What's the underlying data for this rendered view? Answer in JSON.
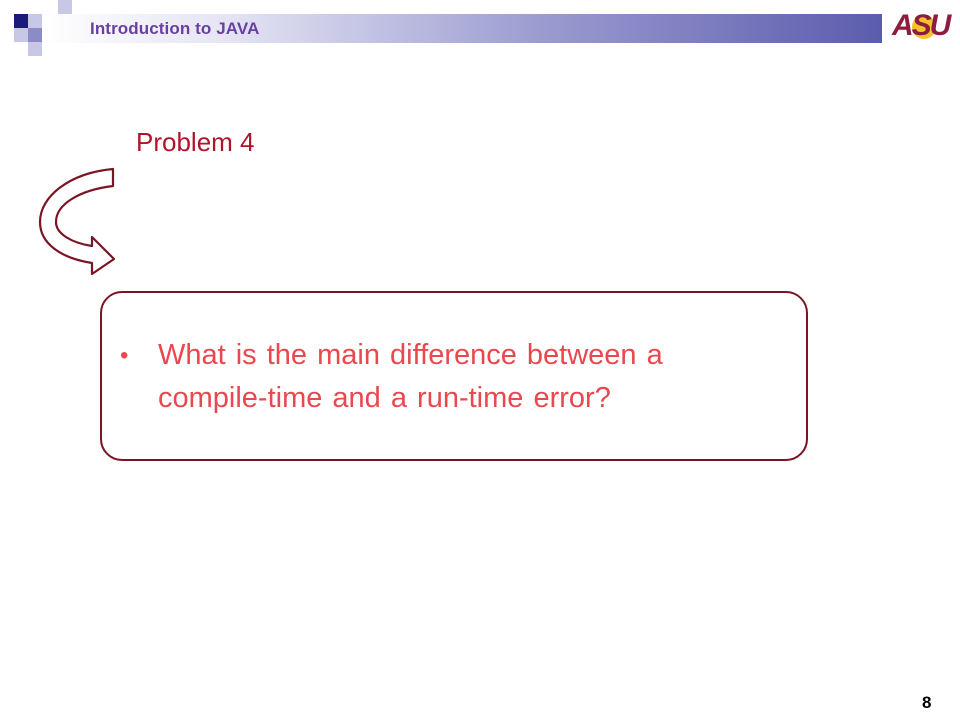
{
  "header": {
    "title": "Introduction to JAVA",
    "logo_text": "ASU"
  },
  "slide": {
    "problem_title": "Problem 4",
    "bullet": "•",
    "question": "What is the main difference between a compile-time and a run-time error?",
    "page_number": "8"
  },
  "colors": {
    "title_red": "#b0142a",
    "question_red": "#e8484e",
    "box_border": "#7a1525",
    "header_purple": "#6a3fa0",
    "asu_maroon": "#8c1d40"
  },
  "icons": [
    "curved-arrow-icon"
  ]
}
